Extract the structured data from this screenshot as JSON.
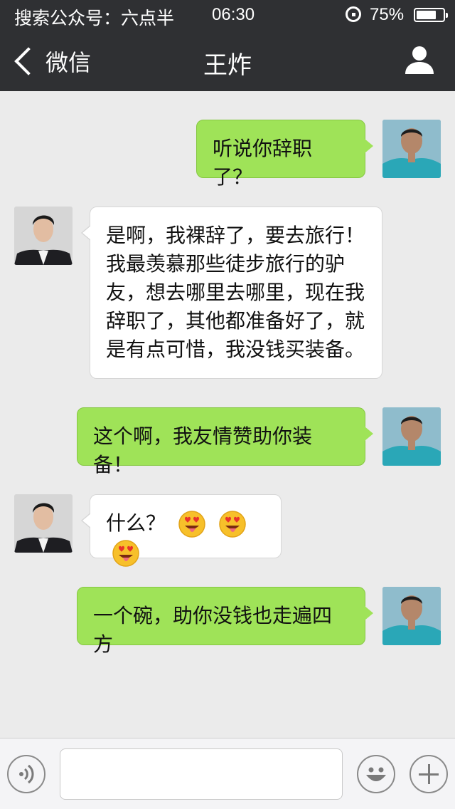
{
  "status_bar": {
    "carrier": "搜索公众号：六点半",
    "time": "06:30",
    "battery_percent": "75%",
    "battery_level": 0.75
  },
  "nav": {
    "back_label": "微信",
    "title": "王炸"
  },
  "messages": [
    {
      "from": "self",
      "text": "听说你辞职了？"
    },
    {
      "from": "other",
      "lines": [
        "是啊，我裸辞了，要去旅行！",
        "我最羡慕那些徒步旅行的驴",
        "友，想去哪里去哪里，现在我",
        "辞职了，其他都准备好了，就",
        "是有点可惜，我没钱买装备。"
      ]
    },
    {
      "from": "self",
      "text": "这个啊，我友情赞助你装备！"
    },
    {
      "from": "other",
      "text": "什么？",
      "emojis": [
        "heart-eyes-tongue-emoji",
        "heart-eyes-tongue-emoji",
        "heart-eyes-tongue-emoji"
      ]
    },
    {
      "from": "self",
      "text": "一个碗，助你没钱也走遍四方"
    }
  ],
  "input_bar": {
    "voice_icon": "voice-icon",
    "emoji_icon": "smiley-icon",
    "more_icon": "plus-icon",
    "message_value": ""
  },
  "colors": {
    "bar": "#2f3033",
    "outgoing_bubble": "#9fe358",
    "incoming_bubble": "#ffffff",
    "background": "#ebebeb"
  }
}
